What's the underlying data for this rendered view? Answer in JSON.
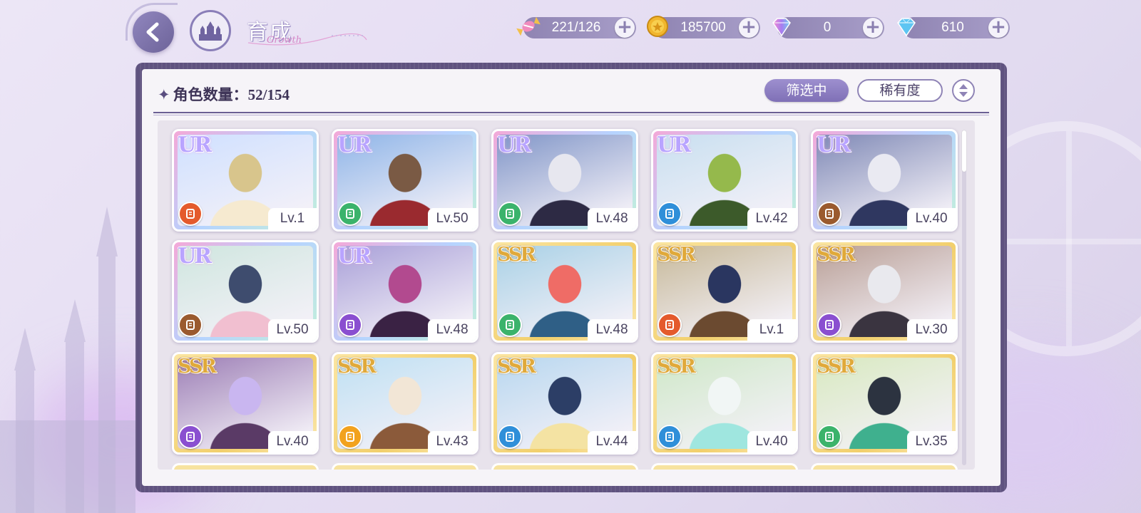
{
  "header": {
    "title": "育成",
    "title_deco": "Growth"
  },
  "resources": [
    {
      "name": "candy",
      "icon": "candy-icon",
      "value": "221/126",
      "color": "#f08bbd"
    },
    {
      "name": "gold",
      "icon": "gold-coin-icon",
      "value": "185700",
      "color": "#f1b62e"
    },
    {
      "name": "rainbow-diamond",
      "icon": "rainbow-diamond-icon",
      "value": "0",
      "color": "#c77ee8"
    },
    {
      "name": "diamond",
      "icon": "diamond-icon",
      "value": "610",
      "color": "#5ec5f2"
    }
  ],
  "panel": {
    "count_label": "角色数量：",
    "count_value": "52/154",
    "filter_button": "筛选中",
    "sort_button": "稀有度"
  },
  "cards": [
    {
      "rarity": "UR",
      "level": "Lv.1",
      "type_color": "#e45a2c",
      "art": [
        "#cfe0ff",
        "#f6ead0",
        "#d8c58c"
      ]
    },
    {
      "rarity": "UR",
      "level": "Lv.50",
      "type_color": "#3bb36b",
      "art": [
        "#8fb5e8",
        "#9a2a2f",
        "#7a5a44"
      ]
    },
    {
      "rarity": "UR",
      "level": "Lv.48",
      "type_color": "#3bb36b",
      "art": [
        "#8196c8",
        "#2d2a44",
        "#e7e7ef"
      ]
    },
    {
      "rarity": "UR",
      "level": "Lv.42",
      "type_color": "#2f8fd9",
      "art": [
        "#c8dff0",
        "#3c5a2a",
        "#95b94c"
      ]
    },
    {
      "rarity": "UR",
      "level": "Lv.40",
      "type_color": "#9a5a2e",
      "art": [
        "#7f89b6",
        "#2f3760",
        "#eaeaf2"
      ]
    },
    {
      "rarity": "UR",
      "level": "Lv.50",
      "type_color": "#9a5a2e",
      "art": [
        "#cfe6df",
        "#f1bfd0",
        "#3e4c6e"
      ]
    },
    {
      "rarity": "UR",
      "level": "Lv.48",
      "type_color": "#8a4fd0",
      "art": [
        "#a9a0d8",
        "#3a2244",
        "#b24a8f"
      ]
    },
    {
      "rarity": "SSR",
      "level": "Lv.48",
      "type_color": "#3bb36b",
      "art": [
        "#a9d1e6",
        "#2f5f86",
        "#ef6c66"
      ]
    },
    {
      "rarity": "SSR",
      "level": "Lv.1",
      "type_color": "#e45a2c",
      "art": [
        "#c7b99a",
        "#6b4a30",
        "#2a3660"
      ]
    },
    {
      "rarity": "SSR",
      "level": "Lv.30",
      "type_color": "#8a4fd0",
      "art": [
        "#b99f96",
        "#3a3440",
        "#e9e9ee"
      ]
    },
    {
      "rarity": "SSR",
      "level": "Lv.40",
      "type_color": "#8a4fd0",
      "art": [
        "#9d7fb6",
        "#5a3a66",
        "#c9b6f0"
      ]
    },
    {
      "rarity": "SSR",
      "level": "Lv.43",
      "type_color": "#f2a21e",
      "art": [
        "#bfe0f3",
        "#8b5a3a",
        "#f2e6d6"
      ]
    },
    {
      "rarity": "SSR",
      "level": "Lv.44",
      "type_color": "#2f8fd9",
      "art": [
        "#b8d7ef",
        "#f4e3a3",
        "#2c3e66"
      ]
    },
    {
      "rarity": "SSR",
      "level": "Lv.40",
      "type_color": "#2f8fd9",
      "art": [
        "#cfe8c8",
        "#9fe6df",
        "#f1f6f5"
      ]
    },
    {
      "rarity": "SSR",
      "level": "Lv.35",
      "type_color": "#3bb36b",
      "art": [
        "#d8e9c0",
        "#3fb08e",
        "#2c3340"
      ]
    }
  ]
}
